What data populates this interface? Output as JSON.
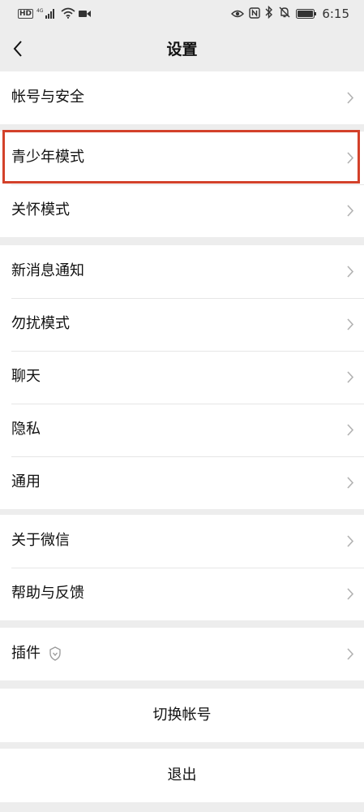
{
  "status_bar": {
    "network": "4G",
    "hd": "HD",
    "time": "6:15",
    "icons": [
      "hd-icon",
      "signal-icon",
      "wifi-icon",
      "video-icon",
      "eye-icon",
      "nfc-icon",
      "bluetooth-icon",
      "mute-icon",
      "battery-icon"
    ]
  },
  "nav": {
    "title": "设置",
    "back_icon": "chevron-left-icon"
  },
  "groups": {
    "account": [
      "帐号与安全"
    ],
    "modes": [
      "青少年模式",
      "关怀模式"
    ],
    "general": [
      "新消息通知",
      "勿扰模式",
      "聊天",
      "隐私",
      "通用"
    ],
    "about": [
      "关于微信",
      "帮助与反馈"
    ],
    "plugins": [
      "插件"
    ]
  },
  "actions": {
    "switch_account": "切换帐号",
    "logout": "退出"
  },
  "colors": {
    "background": "#ededed",
    "cell": "#ffffff",
    "highlight_border": "#d3412a",
    "chevron": "#b2b2b2"
  }
}
